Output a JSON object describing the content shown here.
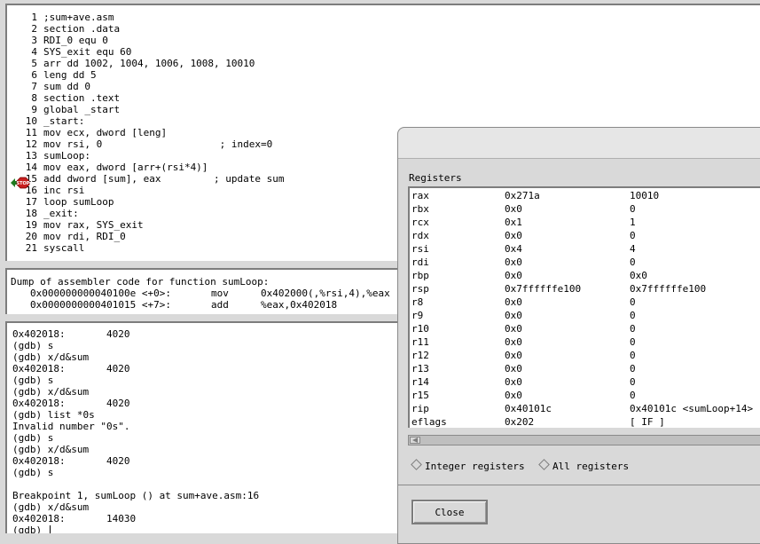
{
  "source": {
    "lines": [
      {
        "num": "1",
        "code": ";sum+ave.asm"
      },
      {
        "num": "2",
        "code": "section .data"
      },
      {
        "num": "3",
        "code": "RDI_0 equ 0"
      },
      {
        "num": "4",
        "code": "SYS_exit equ 60"
      },
      {
        "num": "5",
        "code": "arr dd 1002, 1004, 1006, 1008, 10010"
      },
      {
        "num": "6",
        "code": "leng dd 5"
      },
      {
        "num": "7",
        "code": "sum dd 0"
      },
      {
        "num": "8",
        "code": "section .text"
      },
      {
        "num": "9",
        "code": "global _start"
      },
      {
        "num": "10",
        "code": "_start:"
      },
      {
        "num": "11",
        "code": "mov ecx, dword [leng]"
      },
      {
        "num": "12",
        "code": "mov rsi, 0                    ; index=0"
      },
      {
        "num": "13",
        "code": "sumLoop:"
      },
      {
        "num": "14",
        "code": "mov eax, dword [arr+(rsi*4)]"
      },
      {
        "num": "15",
        "code": "add dword [sum], eax         ; update sum"
      },
      {
        "num": "16",
        "code": "inc rsi"
      },
      {
        "num": "17",
        "code": "loop sumLoop"
      },
      {
        "num": "18",
        "code": "_exit:"
      },
      {
        "num": "19",
        "code": "mov rax, SYS_exit"
      },
      {
        "num": "20",
        "code": "mov rdi, RDI_0"
      },
      {
        "num": "21",
        "code": "syscall"
      }
    ],
    "stop_label": "STOP"
  },
  "assembler": {
    "header": "Dump of assembler code for function sumLoop:",
    "rows": [
      {
        "addr": "0x000000000040100e <+0>:",
        "op": "mov",
        "args": "0x402000(,%rsi,4),%eax"
      },
      {
        "addr": "0x0000000000401015 <+7>:",
        "op": "add",
        "args": "%eax,0x402018"
      }
    ]
  },
  "console": {
    "lines": [
      "0x402018:       4020",
      "(gdb) s",
      "(gdb) x/d&sum",
      "0x402018:       4020",
      "(gdb) s",
      "(gdb) x/d&sum",
      "0x402018:       4020",
      "(gdb) list *0s",
      "Invalid number \"0s\".",
      "(gdb) s",
      "(gdb) x/d&sum",
      "0x402018:       4020",
      "(gdb) s",
      "",
      "Breakpoint 1, sumLoop () at sum+ave.asm:16",
      "(gdb) x/d&sum",
      "0x402018:       14030",
      "(gdb) "
    ]
  },
  "registers": {
    "heading": "Registers",
    "rows": [
      {
        "name": "rax",
        "hex": "0x271a",
        "value": "10010"
      },
      {
        "name": "rbx",
        "hex": "0x0",
        "value": "0"
      },
      {
        "name": "rcx",
        "hex": "0x1",
        "value": "1"
      },
      {
        "name": "rdx",
        "hex": "0x0",
        "value": "0"
      },
      {
        "name": "rsi",
        "hex": "0x4",
        "value": "4"
      },
      {
        "name": "rdi",
        "hex": "0x0",
        "value": "0"
      },
      {
        "name": "rbp",
        "hex": "0x0",
        "value": "0x0"
      },
      {
        "name": "rsp",
        "hex": "0x7ffffffe100",
        "value": "0x7ffffffe100"
      },
      {
        "name": "r8",
        "hex": "0x0",
        "value": "0"
      },
      {
        "name": "r9",
        "hex": "0x0",
        "value": "0"
      },
      {
        "name": "r10",
        "hex": "0x0",
        "value": "0"
      },
      {
        "name": "r11",
        "hex": "0x0",
        "value": "0"
      },
      {
        "name": "r12",
        "hex": "0x0",
        "value": "0"
      },
      {
        "name": "r13",
        "hex": "0x0",
        "value": "0"
      },
      {
        "name": "r14",
        "hex": "0x0",
        "value": "0"
      },
      {
        "name": "r15",
        "hex": "0x0",
        "value": "0"
      },
      {
        "name": "rip",
        "hex": "0x40101c",
        "value": "0x40101c <sumLoop+14>"
      },
      {
        "name": "eflags",
        "hex": "0x202",
        "value": "[ IF ]"
      }
    ],
    "radio_integer": "Integer registers",
    "radio_all": "All registers",
    "close_label": "Close"
  }
}
